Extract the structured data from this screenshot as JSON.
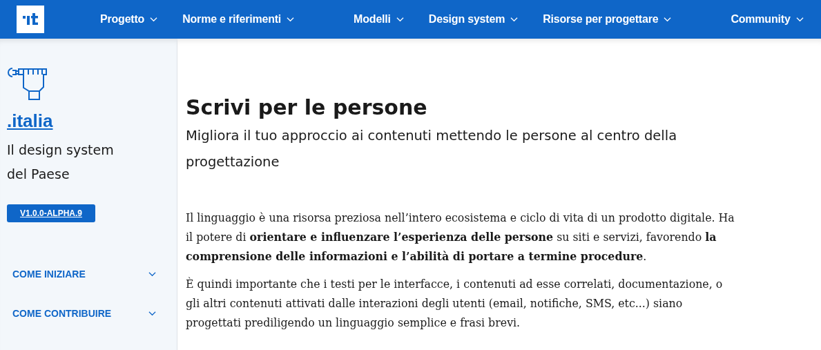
{
  "header": {
    "nav": [
      {
        "label": "Progetto"
      },
      {
        "label": "Norme e riferimenti"
      },
      {
        "label": "Modelli"
      },
      {
        "label": "Design system"
      },
      {
        "label": "Risorse per progettare"
      },
      {
        "label": "Community"
      }
    ]
  },
  "sidebar": {
    "brand": ".italia",
    "tagline_lines": [
      "Il design system",
      "del Paese"
    ],
    "version": "V1.0.0-ALPHA.9",
    "menu": [
      {
        "label": "COME INIZIARE",
        "expanded": false
      },
      {
        "label": "COME CONTRIBUIRE",
        "expanded": false
      }
    ]
  },
  "main": {
    "title": "Scrivi per le persone",
    "subtitle": "Migliora il tuo approccio ai contenuti mettendo le persone al centro della progettazione",
    "paragraphs": [
      "Il linguaggio è una risorsa preziosa nell’intero ecosistema e ciclo di vita di un prodotto digitale. Ha il potere di **orientare e influenzare l’esperienza delle persone** su siti e servizi, favorendo **la comprensione delle informazioni e l’abilità di portare a termine procedure**.",
      "È quindi importante che i testi per le interfacce, i contenuti ad esse correlati, documentazione, o gli altri contenuti attivati dalle interazioni degli utenti (email, notifiche, SMS, etc...) siano progettati prediligendo un linguaggio semplice e frasi brevi."
    ]
  }
}
